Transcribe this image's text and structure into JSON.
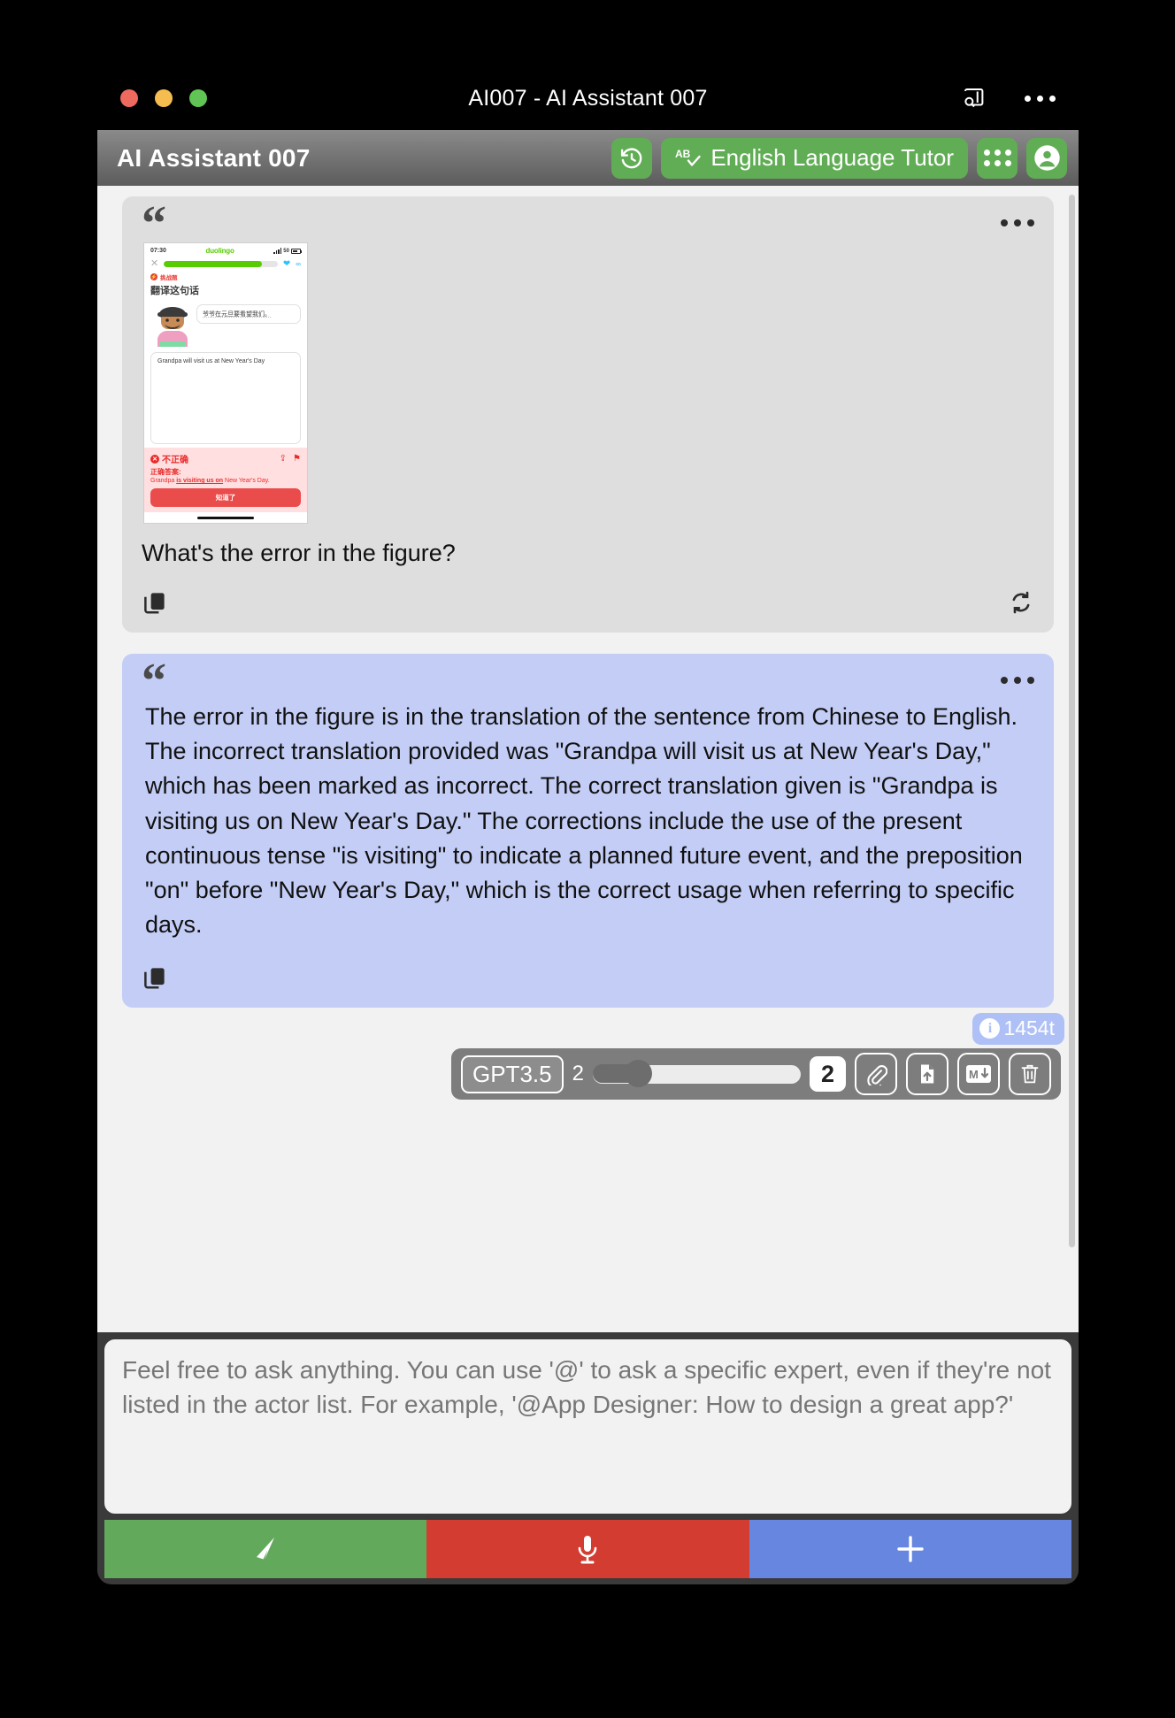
{
  "window": {
    "title": "AI007 - AI Assistant 007",
    "titlebar_icons": [
      {
        "name": "sidebar-search-icon",
        "label": "search-sidebar"
      },
      {
        "name": "more-options-icon",
        "label": "more"
      }
    ]
  },
  "toolbar": {
    "app_title": "AI Assistant 007",
    "history_label": "history",
    "actor_label": "English Language Tutor",
    "actor_icon_text": "AB",
    "grid_label": "apps",
    "account_label": "account"
  },
  "messages": [
    {
      "role": "user",
      "text": "What's the error in the figure?",
      "menu_label": "message-options",
      "actions": [
        "copy",
        "regenerate"
      ],
      "attachment": {
        "type": "phone-screenshot",
        "app": "duolingo",
        "status_time": "07:30",
        "signal": "50",
        "challenge_tag": "挑战题",
        "instruction": "翻译这句话",
        "chinese_prompt": "爷爷在元旦要看望我们。",
        "user_answer": "Grandpa will visit us at New Year's Day",
        "result_title": "不正确",
        "correct_label": "正确答案:",
        "correct_pre": "Grandpa ",
        "correct_bold": "is visiting us on",
        "correct_post": " New Year's Day.",
        "cta": "知道了"
      }
    },
    {
      "role": "assistant",
      "text": "The error in the figure is in the translation of the sentence from Chinese to English. The incorrect translation provided was \"Grandpa will visit us at New Year's Day,\" which has been marked as incorrect. The correct translation given is \"Grandpa is visiting us on New Year's Day.\" The corrections include the use of the present continuous tense \"is visiting\" to indicate a planned future event, and the preposition \"on\" before \"New Year's Day,\" which is the correct usage when referring to specific days.",
      "menu_label": "message-options",
      "actions": [
        "copy"
      ]
    }
  ],
  "token_counter": {
    "value": "1454t",
    "info_glyph": "i"
  },
  "modelbar": {
    "model": "GPT3.5",
    "slider_min_label": "2",
    "slider_value": "2",
    "buttons": [
      {
        "name": "attach-file-button",
        "label": "attach"
      },
      {
        "name": "upload-file-button",
        "label": "upload"
      },
      {
        "name": "markdown-button",
        "label": "M"
      },
      {
        "name": "delete-button",
        "label": "delete"
      }
    ]
  },
  "composer": {
    "placeholder": "Feel free to ask anything. You can use '@' to ask a specific expert, even if they're not listed in the actor list. For example, '@App Designer: How to design a great app?'",
    "value": "",
    "actions": [
      {
        "name": "send-button",
        "label": "send",
        "color": "#63a95c"
      },
      {
        "name": "microphone-button",
        "label": "microphone",
        "color": "#d33c30"
      },
      {
        "name": "add-button",
        "label": "add",
        "color": "#6786e0"
      }
    ]
  },
  "colors": {
    "accent_green": "#61ad55",
    "user_bubble": "#dedede",
    "ai_bubble": "#c3cdf5",
    "send": "#63a95c",
    "mic": "#d33c30",
    "plus": "#6786e0"
  }
}
